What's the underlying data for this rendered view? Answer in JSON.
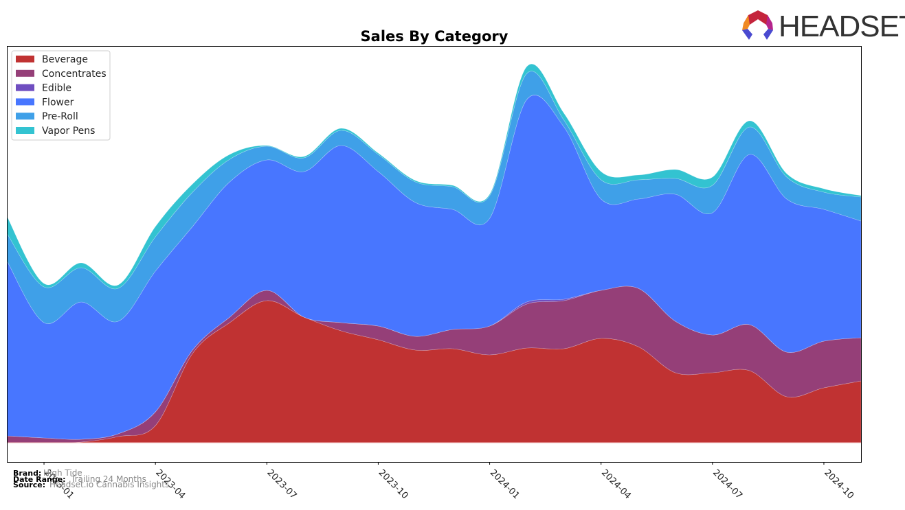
{
  "logo": {
    "text": "HEADSET"
  },
  "footer": {
    "brand_label": "Brand:",
    "brand_value": "High Tide",
    "date_label": "Date Range:",
    "date_value": "Trailing 24 Months",
    "source_label": "Source:",
    "source_value": "Headset.io Cannabis Insights"
  },
  "chart_data": {
    "type": "area",
    "title": "Sales By Category",
    "xlabel": "",
    "ylabel": "",
    "stacked": true,
    "smooth": true,
    "x": [
      "2022-12",
      "2023-01",
      "2023-02",
      "2023-03",
      "2023-04",
      "2023-05",
      "2023-06",
      "2023-07",
      "2023-08",
      "2023-09",
      "2023-10",
      "2023-11",
      "2023-12",
      "2024-01",
      "2024-02",
      "2024-03",
      "2024-04",
      "2024-05",
      "2024-06",
      "2024-07",
      "2024-08",
      "2024-09",
      "2024-10",
      "2024-11"
    ],
    "x_ticks": [
      "2023-01",
      "2023-04",
      "2023-07",
      "2023-10",
      "2024-01",
      "2024-04",
      "2024-07",
      "2024-10"
    ],
    "ylim": [
      -28,
      578
    ],
    "y_ticks_visible": false,
    "grid": false,
    "legend_position": "top-left",
    "series": [
      {
        "name": "Beverage",
        "color": "#c03232",
        "values": [
          0,
          0,
          1,
          9,
          25,
          130,
          175,
          207,
          183,
          163,
          150,
          135,
          137,
          128,
          138,
          137,
          152,
          140,
          102,
          102,
          105,
          67,
          80,
          90
        ]
      },
      {
        "name": "Concentrates",
        "color": "#953f78",
        "values": [
          10,
          7,
          4,
          4,
          20,
          5,
          8,
          15,
          0,
          12,
          20,
          20,
          28,
          42,
          64,
          70,
          70,
          85,
          75,
          55,
          67,
          65,
          68,
          63
        ]
      },
      {
        "name": "Edible",
        "color": "#6f4ec0",
        "values": [
          0,
          0,
          0,
          0,
          0,
          0,
          0,
          0,
          0,
          0,
          0,
          0,
          0,
          0,
          3,
          2,
          0,
          0,
          0,
          0,
          0,
          0,
          0,
          0
        ]
      },
      {
        "name": "Flower",
        "color": "#4876ff",
        "values": [
          255,
          168,
          200,
          164,
          205,
          180,
          197,
          190,
          212,
          258,
          225,
          195,
          175,
          157,
          295,
          251,
          133,
          130,
          185,
          178,
          248,
          223,
          192,
          170
        ]
      },
      {
        "name": "Pre-Roll",
        "color": "#3fa0e8",
        "values": [
          40,
          52,
          50,
          48,
          50,
          50,
          33,
          20,
          20,
          22,
          25,
          30,
          33,
          33,
          38,
          10,
          28,
          28,
          23,
          40,
          40,
          32,
          25,
          35
        ]
      },
      {
        "name": "Vapor Pens",
        "color": "#33c3d1",
        "values": [
          25,
          5,
          7,
          5,
          15,
          12,
          7,
          1,
          2,
          3,
          2,
          2,
          2,
          2,
          10,
          10,
          12,
          7,
          13,
          12,
          9,
          5,
          5,
          2
        ]
      }
    ]
  }
}
